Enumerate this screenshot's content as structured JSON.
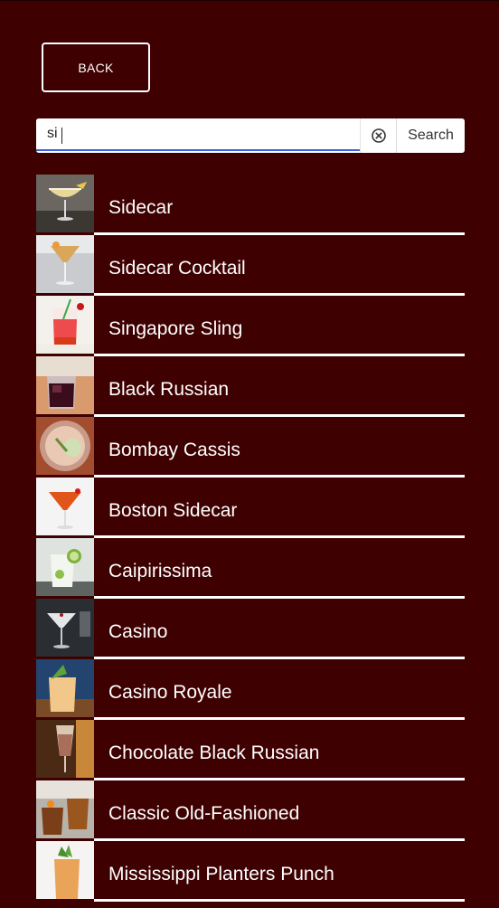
{
  "back_label": "BACK",
  "search": {
    "value": "si",
    "button_label": "Search"
  },
  "results": [
    {
      "name": "Sidecar",
      "icon": "sidecar-photo"
    },
    {
      "name": "Sidecar Cocktail",
      "icon": "sidecar-cocktail-photo"
    },
    {
      "name": "Singapore Sling",
      "icon": "singapore-sling-photo"
    },
    {
      "name": "Black Russian",
      "icon": "black-russian-photo"
    },
    {
      "name": "Bombay Cassis",
      "icon": "bombay-cassis-photo"
    },
    {
      "name": "Boston Sidecar",
      "icon": "boston-sidecar-photo"
    },
    {
      "name": "Caipirissima",
      "icon": "caipirissima-photo"
    },
    {
      "name": "Casino",
      "icon": "casino-photo"
    },
    {
      "name": "Casino Royale",
      "icon": "casino-royale-photo"
    },
    {
      "name": "Chocolate Black Russian",
      "icon": "chocolate-black-russian-photo"
    },
    {
      "name": "Classic Old-Fashioned",
      "icon": "classic-old-fashioned-photo"
    },
    {
      "name": "Mississippi Planters Punch",
      "icon": "mississippi-planters-punch-photo"
    }
  ],
  "colors": {
    "background": "#3e0000",
    "divider": "#ffffff",
    "input_focus": "#3f63d6"
  }
}
